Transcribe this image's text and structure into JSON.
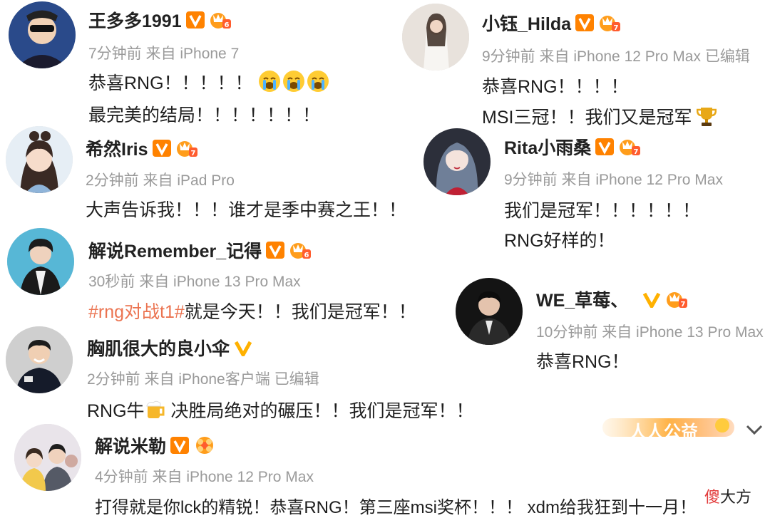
{
  "colors": {
    "topic": "#eb7350",
    "meta": "#9a9a9a",
    "verified": "#ff8200",
    "text": "#1f1f1f"
  },
  "posts": [
    {
      "name": "王多多1991",
      "meta": "7分钟前 来自 iPhone 7",
      "lines": [
        "恭喜RNG！！！！！",
        "最完美的结局！！！！！！！"
      ]
    },
    {
      "name": "小钰_Hilda",
      "meta": "9分钟前 来自 iPhone 12 Pro Max  已编辑",
      "lines": [
        "恭喜RNG！！！！",
        "MSI三冠！！我们又是冠军"
      ]
    },
    {
      "name": "希然Iris",
      "meta": "2分钟前 来自 iPad Pro",
      "lines": [
        "大声告诉我！！！谁才是季中赛之王！！"
      ]
    },
    {
      "name": "Rita小雨桑",
      "meta": "9分钟前 来自 iPhone 12 Pro Max",
      "lines": [
        "我们是冠军！！！！！！",
        "RNG好样的！"
      ]
    },
    {
      "name": "解说Remember_记得",
      "meta": "30秒前 来自 iPhone 13 Pro Max",
      "topic": "#rng对战t1#",
      "lines": [
        "就是今天！！我们是冠军！！"
      ]
    },
    {
      "name": "WE_草莓、",
      "meta": "10分钟前 来自 iPhone 13 Pro Max",
      "lines": [
        "恭喜RNG！"
      ]
    },
    {
      "name": "胸肌很大的良小伞",
      "meta": "2分钟前 来自 iPhone客户端  已编辑",
      "lines": [
        "RNG牛",
        " 决胜局绝对的碾压！！我们是冠军！！"
      ]
    },
    {
      "name": "解说米勒",
      "meta": "4分钟前 来自 iPhone 12 Pro Max",
      "lines": [
        "打得就是你lck的精锐！恭喜RNG！第三座msi奖杯！！！ xdm给我狂到十一月！"
      ]
    }
  ],
  "overlays": {
    "gongyi": "人人公益",
    "sticker_red": "傻",
    "sticker_black": "大方"
  },
  "icons": {
    "verified": "verified-v-icon",
    "level": "crown-level-icon",
    "expand": "chevron-down-icon"
  }
}
